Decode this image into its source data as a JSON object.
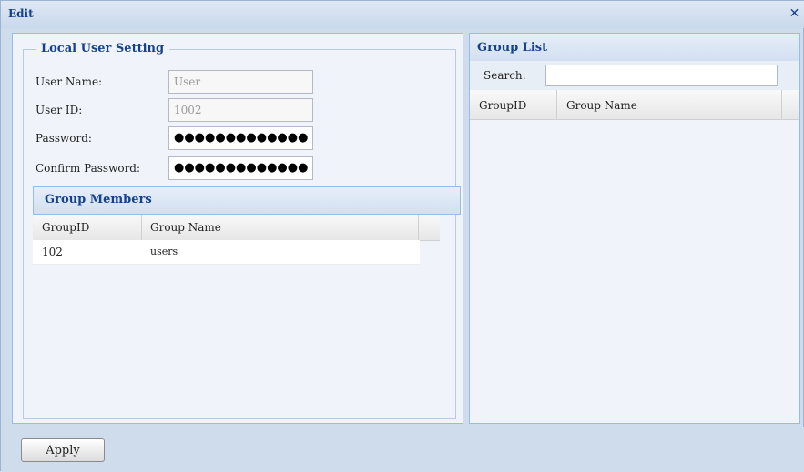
{
  "window": {
    "title": "Edit",
    "close_icon": "close-icon"
  },
  "local_user_setting": {
    "legend": "Local User Setting",
    "user_name_label": "User Name:",
    "user_name_value": "User",
    "user_id_label": "User ID:",
    "user_id_value": "1002",
    "password_label": "Password:",
    "password_value": "●●●●●●●●●●●●●",
    "confirm_password_label": "Confirm Password:",
    "confirm_password_value": "●●●●●●●●●●●●●"
  },
  "group_members": {
    "title": "Group Members",
    "columns": [
      "GroupID",
      "Group Name"
    ],
    "rows": [
      {
        "group_id": "102",
        "group_name": "users"
      }
    ]
  },
  "group_list": {
    "title": "Group List",
    "search_label": "Search:",
    "search_value": "",
    "columns": [
      "GroupID",
      "Group Name"
    ]
  },
  "footer": {
    "apply_label": "Apply"
  },
  "colors": {
    "accent": "#15428b",
    "panel_border": "#99bbe8",
    "background": "#cfdcec"
  }
}
